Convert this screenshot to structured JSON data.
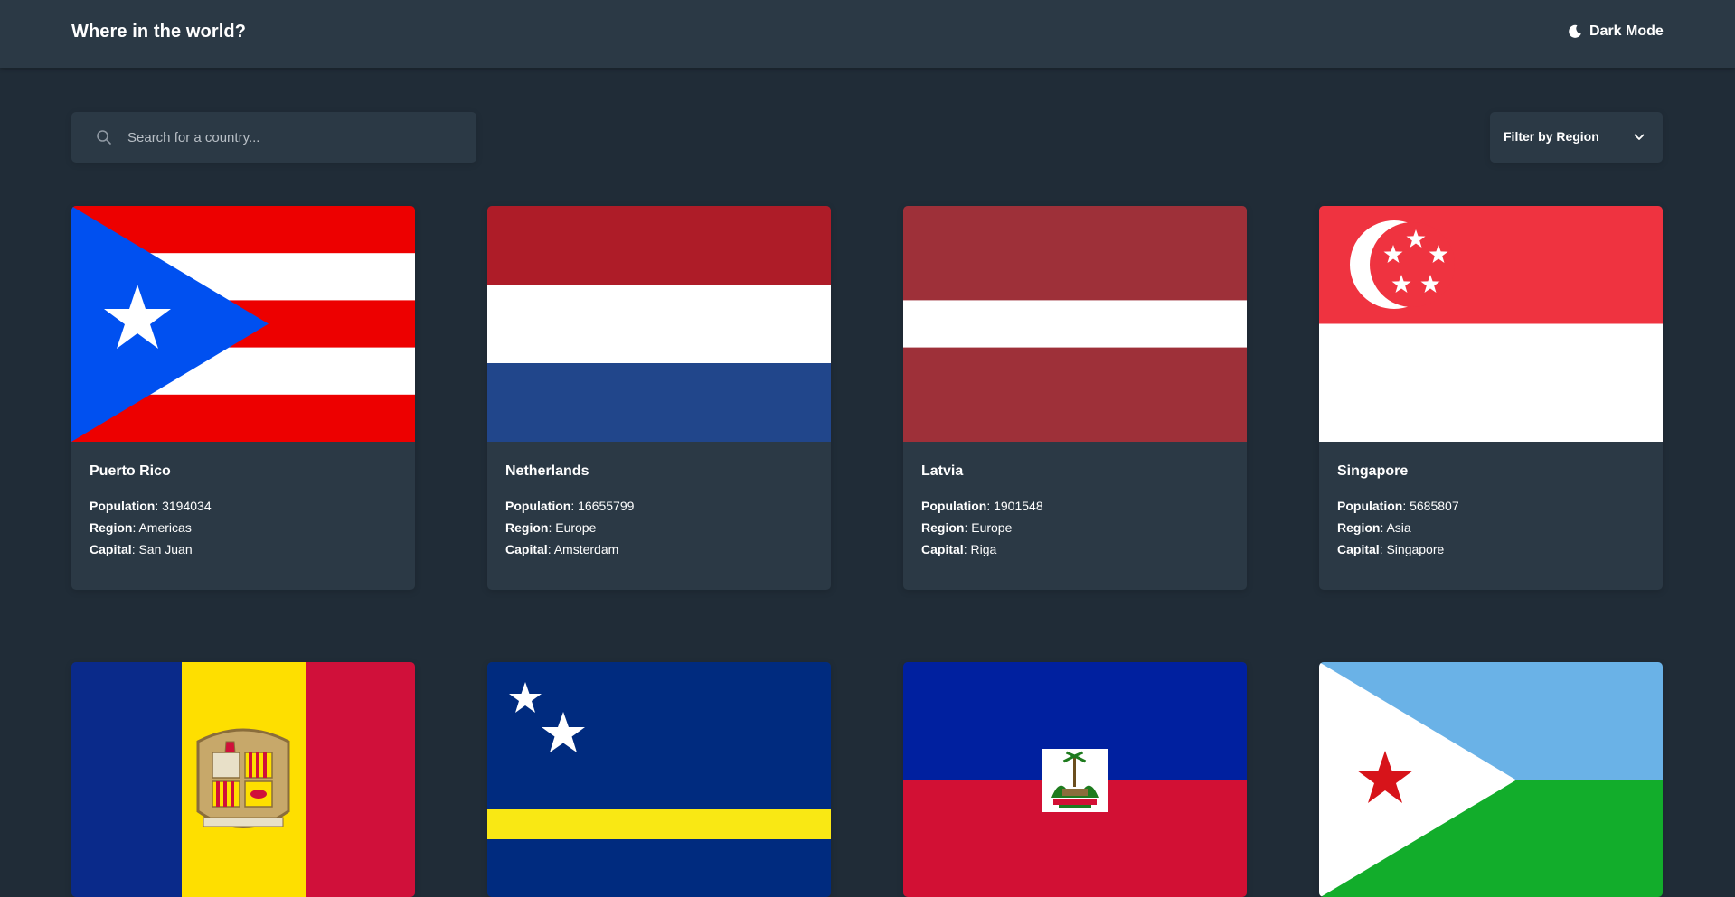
{
  "header": {
    "title": "Where in the world?",
    "theme_toggle_label": "Dark Mode",
    "theme_icon": "moon-icon"
  },
  "search": {
    "placeholder": "Search for a country...",
    "value": "",
    "icon": "search-icon"
  },
  "filter": {
    "label": "Filter by Region",
    "icon": "chevron-down-icon"
  },
  "stat_labels": {
    "population": "Population",
    "region": "Region",
    "capital": "Capital",
    "separator": ":"
  },
  "countries": [
    {
      "name": "Puerto Rico",
      "population": "3194034",
      "region": "Americas",
      "capital": "San Juan",
      "flag_icon": "puerto-rico-flag"
    },
    {
      "name": "Netherlands",
      "population": "16655799",
      "region": "Europe",
      "capital": "Amsterdam",
      "flag_icon": "netherlands-flag"
    },
    {
      "name": "Latvia",
      "population": "1901548",
      "region": "Europe",
      "capital": "Riga",
      "flag_icon": "latvia-flag"
    },
    {
      "name": "Singapore",
      "population": "5685807",
      "region": "Asia",
      "capital": "Singapore",
      "flag_icon": "singapore-flag"
    },
    {
      "flag_icon": "andorra-flag"
    },
    {
      "flag_icon": "curacao-flag"
    },
    {
      "flag_icon": "haiti-flag"
    },
    {
      "flag_icon": "djibouti-flag"
    }
  ],
  "colors": {
    "background": "#202c37",
    "element": "#2b3945",
    "text": "#ffffff"
  }
}
